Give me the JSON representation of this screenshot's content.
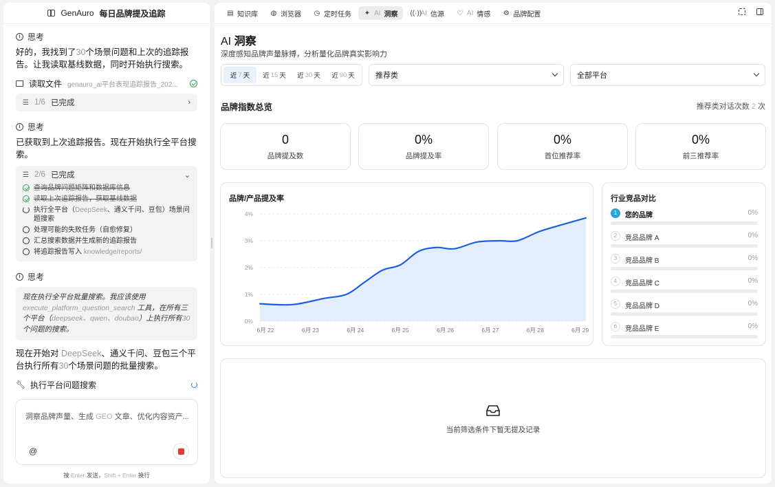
{
  "left": {
    "brand": "GenAuro",
    "title": "每日品牌提及追踪",
    "think1": {
      "label": "思考",
      "text_a": "好的，我找到了",
      "text_num": "30",
      "text_b": "个场景问题和上次的追踪报告。让我读取基线数据，同时开始执行搜索。"
    },
    "read_file": {
      "label": "读取文件",
      "file": "genauro_ai平台表现追踪报告_202..."
    },
    "task1": {
      "count": "1/6",
      "status": "已完成"
    },
    "think2": {
      "label": "思考",
      "text": "已获取到上次追踪报告。现在开始执行全平台搜索。"
    },
    "task2": {
      "count": "2/6",
      "status": "已完成",
      "items": [
        {
          "state": "done",
          "text": "查询品牌问题矩阵和数据库信息"
        },
        {
          "state": "done",
          "text": "读取上次追踪报告，获取基线数据"
        },
        {
          "state": "running",
          "text_a": "执行全平台（",
          "lite": "DeepSeek",
          "text_b": "、通义千问、豆包）场景问题搜索"
        },
        {
          "state": "open",
          "text": "处理可能的失败任务（自愈修复）"
        },
        {
          "state": "open",
          "text": "汇总搜索数据并生成新的追踪报告"
        },
        {
          "state": "open",
          "text_a": "将追踪报告写入 ",
          "lite": "knowledge/reports/"
        }
      ]
    },
    "think3": {
      "label": "思考",
      "quote_a": "现在执行全平台批量搜索。我应该使用 ",
      "quote_code": "execute_platform_question_search",
      "quote_b": " 工具，在所有三个平台（",
      "quote_lite": "deepseek、qwen、doubao",
      "quote_c": "）上执行所有",
      "quote_num": "30",
      "quote_d": "个问题的搜索。"
    },
    "msg": {
      "a": "现在开始对 ",
      "lite": "DeepSeek",
      "b": "、通义千问、豆包三个平台执行所有",
      "num": "30",
      "c": "个场景问题的批量搜索。"
    },
    "exec_tool": "执行平台问题搜索",
    "input": {
      "placeholder_a": "洞察品牌声量、生成 ",
      "placeholder_lite": "GEO",
      "placeholder_b": " 文章、优化内容资产..."
    },
    "at_symbol": "@",
    "hint": {
      "a": "按 ",
      "k1": "Enter",
      "b": " 发送，",
      "k2": "Shift + Enter",
      "c": " 换行"
    }
  },
  "tabs": [
    {
      "label": "知识库",
      "icon": "doc-icon",
      "active": false
    },
    {
      "label": "浏览器",
      "icon": "globe-icon",
      "active": false
    },
    {
      "label": "定时任务",
      "icon": "clock-icon",
      "active": false
    },
    {
      "label_lite": "AI",
      "label": "洞察",
      "icon": "sparkle-icon",
      "active": true
    },
    {
      "label_lite": "AI",
      "label": "信源",
      "icon": "broadcast-icon",
      "active": false
    },
    {
      "label_lite": "AI",
      "label": "情感",
      "icon": "heart-icon",
      "active": false
    },
    {
      "label": "品牌配置",
      "icon": "gear-icon",
      "active": false
    }
  ],
  "page": {
    "title_lite": "AI",
    "title": "洞察",
    "subtitle": "深度感知品牌声量脉搏，分析量化品牌真实影响力"
  },
  "range": [
    {
      "a": "近",
      "n": "7",
      "b": "天",
      "active": true
    },
    {
      "a": "近",
      "n": "15",
      "b": "天",
      "active": false
    },
    {
      "a": "近",
      "n": "30",
      "b": "天",
      "active": false
    },
    {
      "a": "近",
      "n": "90",
      "b": "天",
      "active": false
    }
  ],
  "filters": {
    "category": "推荐类",
    "platform": "全部平台"
  },
  "overview": {
    "title": "品牌指数总览",
    "right_a": "推荐类对话次数 ",
    "right_num": "2",
    "right_b": " 次",
    "kpis": [
      {
        "value": "0",
        "label": "品牌提及数"
      },
      {
        "value": "0%",
        "label": "品牌提及率"
      },
      {
        "value": "0%",
        "label": "首位推荐率"
      },
      {
        "value": "0%",
        "label": "前三推荐率"
      }
    ]
  },
  "chart_data": {
    "type": "area",
    "title": "品牌/产品提及率",
    "x": [
      "6月 22",
      "6月 23",
      "6月 24",
      "6月 25",
      "6月 26",
      "6月 27",
      "6月 28",
      "6月 29"
    ],
    "x_pos": [
      0,
      1,
      2,
      3,
      4,
      5,
      6,
      7
    ],
    "curve": [
      [
        0,
        0.65
      ],
      [
        0.6,
        0.62
      ],
      [
        1.3,
        0.85
      ],
      [
        1.8,
        1.0
      ],
      [
        2.2,
        1.45
      ],
      [
        2.6,
        1.9
      ],
      [
        3.0,
        2.1
      ],
      [
        3.4,
        2.6
      ],
      [
        3.8,
        2.75
      ],
      [
        4.2,
        2.7
      ],
      [
        4.7,
        2.95
      ],
      [
        5.2,
        3.0
      ],
      [
        5.6,
        3.0
      ],
      [
        6.1,
        3.35
      ],
      [
        6.6,
        3.6
      ],
      [
        7.1,
        3.85
      ]
    ],
    "yticks": [
      "0%",
      "1%",
      "2%",
      "3%",
      "4%"
    ],
    "ylim": [
      0,
      4
    ],
    "color": "#1a5fe0",
    "fill": "#e3edfb",
    "grid": true
  },
  "competitors": {
    "title": "行业竞品对比",
    "rows": [
      {
        "rank": "1",
        "name": "您的品牌",
        "pct": "0%",
        "value": 0,
        "first": true
      },
      {
        "rank": "2",
        "name": "竞品品牌 A",
        "pct": "0%",
        "value": 0,
        "first": false
      },
      {
        "rank": "3",
        "name": "竞品品牌 B",
        "pct": "0%",
        "value": 0,
        "first": false
      },
      {
        "rank": "4",
        "name": "竞品品牌 C",
        "pct": "0%",
        "value": 0,
        "first": false
      },
      {
        "rank": "5",
        "name": "竞品品牌 D",
        "pct": "0%",
        "value": 0,
        "first": false
      },
      {
        "rank": "6",
        "name": "竞品品牌 E",
        "pct": "0%",
        "value": 0,
        "first": false
      }
    ]
  },
  "empty": {
    "text": "当前筛选条件下暂无提及记录",
    "icon": "inbox-icon"
  }
}
